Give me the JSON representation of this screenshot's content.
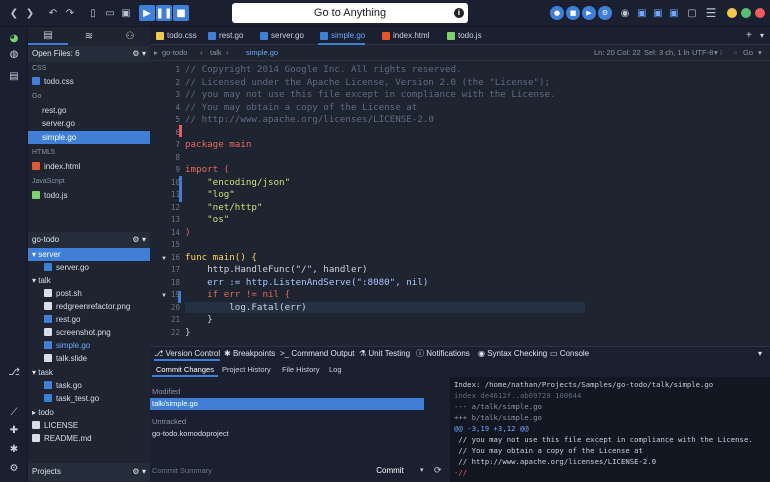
{
  "toolbar": {
    "search_label": "Go to Anything",
    "info_icon": "i"
  },
  "sidebar": {
    "open_files_label": "Open Files: 6",
    "groups": [
      {
        "name": "CSS",
        "files": [
          "todo.css"
        ]
      },
      {
        "name": "Go",
        "files": [
          "rest.go",
          "server.go",
          "simple.go"
        ]
      },
      {
        "name": "HTML5",
        "files": [
          "index.html"
        ]
      },
      {
        "name": "JavaScript",
        "files": [
          "todo.js"
        ]
      }
    ],
    "project_label": "go-todo",
    "tree": [
      "server",
      "server.go",
      "talk",
      "post.sh",
      "redgreenrefactor.png",
      "rest.go",
      "screenshot.png",
      "simple.go",
      "talk.slide",
      "task",
      "task.go",
      "task_test.go",
      "todo",
      "LICENSE",
      "README.md"
    ],
    "projects_label": "Projects"
  },
  "tabs": [
    "todo.css",
    "rest.go",
    "server.go",
    "simple.go",
    "index.html",
    "todo.js"
  ],
  "breadcrumb": {
    "parts": [
      "go-todo",
      "talk",
      "simple.go"
    ],
    "position": "Ln: 20 Col: 22",
    "selection": "Sel: 3 ch, 1 ln",
    "encoding": "UTF-8",
    "language": "Go"
  },
  "editor": {
    "lines": [
      {
        "n": "1",
        "t": "// Copyright 2014 Google Inc. All rights reserved."
      },
      {
        "n": "2",
        "t": "// Licensed under the Apache License, Version 2.0 (the \"License\");"
      },
      {
        "n": "3",
        "t": "// you may not use this file except in compliance with the License."
      },
      {
        "n": "4",
        "t": "// You may obtain a copy of the License at"
      },
      {
        "n": "5",
        "t": "// http://www.apache.org/licenses/LICENSE-2.0"
      },
      {
        "n": "6",
        "t": ""
      },
      {
        "n": "7",
        "t": "package main"
      },
      {
        "n": "8",
        "t": ""
      },
      {
        "n": "9",
        "t": "import ("
      },
      {
        "n": "10",
        "t": "    \"encoding/json\""
      },
      {
        "n": "11",
        "t": "    \"log\""
      },
      {
        "n": "12",
        "t": "    \"net/http\""
      },
      {
        "n": "13",
        "t": "    \"os\""
      },
      {
        "n": "14",
        "t": ")"
      },
      {
        "n": "15",
        "t": ""
      },
      {
        "n": "16",
        "t": "func main() {"
      },
      {
        "n": "17",
        "t": "    http.HandleFunc(\"/\", handler)"
      },
      {
        "n": "18",
        "t": "    err := http.ListenAndServe(\":8080\", nil)"
      },
      {
        "n": "19",
        "t": "    if err != nil {"
      },
      {
        "n": "20",
        "t": "        log.Fatal(err)"
      },
      {
        "n": "21",
        "t": "    }"
      },
      {
        "n": "22",
        "t": "}"
      }
    ]
  },
  "bottom_tabs": [
    "Version Control",
    "Breakpoints",
    "Command Output",
    "Unit Testing",
    "Notifications",
    "Syntax Checking",
    "Console"
  ],
  "vc": {
    "subtabs": [
      "Commit Changes",
      "Project History",
      "File History",
      "Log"
    ],
    "modified_label": "Modified",
    "modified_file": "talk/simple.go",
    "untracked_label": "Untracked",
    "untracked_file": "go-todo.komodoproject",
    "summary_placeholder": "Commit Summary",
    "commit_label": "Commit",
    "diff": [
      "Index: /home/nathan/Projects/Samples/go-todo/talk/simple.go",
      "index de4612f..ab09729 100644",
      "--- a/talk/simple.go",
      "+++ b/talk/simple.go",
      "@@ -3,19 +3,12 @@",
      " // you may not use this file except in compliance with the License.",
      " // You may obtain a copy of the License at",
      " // http://www.apache.org/licenses/LICENSE-2.0",
      "-//"
    ]
  },
  "colors": {
    "accent": "#3f7fd8",
    "bg": "#1e2430"
  }
}
